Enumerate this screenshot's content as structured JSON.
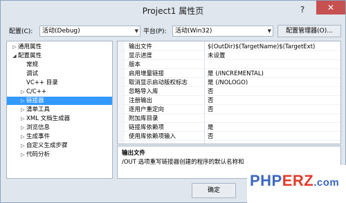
{
  "window": {
    "title": "Project1 属性页",
    "help_label": "?",
    "close_label": "✕"
  },
  "toolbar": {
    "config_label": "配置(C):",
    "config_value": "活动(Debug)",
    "platform_label": "平台(P):",
    "platform_value": "活动(Win32)",
    "config_manager_label": "配置管理器(O)..."
  },
  "tree": {
    "items": [
      {
        "toggle": "▷",
        "label": "通用属性"
      },
      {
        "toggle": "◢",
        "label": "配置属性"
      },
      {
        "toggle": "",
        "label": "常规"
      },
      {
        "toggle": "",
        "label": "调试"
      },
      {
        "toggle": "",
        "label": "VC++ 目录"
      },
      {
        "toggle": "▷",
        "label": "C/C++"
      },
      {
        "toggle": "▷",
        "label": "链接器"
      },
      {
        "toggle": "▷",
        "label": "清单工具"
      },
      {
        "toggle": "▷",
        "label": "XML 文档生成器"
      },
      {
        "toggle": "▷",
        "label": "浏览信息"
      },
      {
        "toggle": "▷",
        "label": "生成事件"
      },
      {
        "toggle": "▷",
        "label": "自定义生成步骤"
      },
      {
        "toggle": "▷",
        "label": "代码分析"
      }
    ]
  },
  "grid": {
    "rows": [
      {
        "name": "输出文件",
        "value": "$(OutDir)$(TargetName)$(TargetExt)"
      },
      {
        "name": "显示进度",
        "value": "未设置"
      },
      {
        "name": "版本",
        "value": ""
      },
      {
        "name": "启用增量链接",
        "value": "是 (/INCREMENTAL)"
      },
      {
        "name": "取消显示启动版权标志",
        "value": "是 (/NOLOGO)"
      },
      {
        "name": "忽略导入库",
        "value": "否"
      },
      {
        "name": "注册输出",
        "value": "否"
      },
      {
        "name": "逐用户重定向",
        "value": "否"
      },
      {
        "name": "附加库目录",
        "value": ""
      },
      {
        "name": "链接库依赖项",
        "value": "是"
      },
      {
        "name": "使用库依赖项输入",
        "value": "否"
      }
    ]
  },
  "description": {
    "title": "输出文件",
    "text": "/OUT 选项重写链接器创建的程序的默认名称和"
  },
  "footer": {
    "ok_label": "确定"
  },
  "watermark": {
    "part1": "PHP",
    "part2": "ERZ",
    "part3": ".com"
  },
  "colors": {
    "selection": "#3399ff",
    "close": "#c75050",
    "chrome": "#dfe6ee"
  }
}
